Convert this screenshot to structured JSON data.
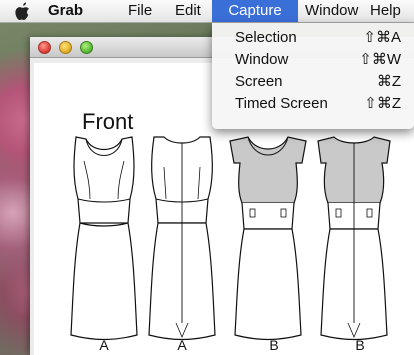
{
  "menubar": {
    "app_name": "Grab",
    "items": [
      "File",
      "Edit",
      "Capture",
      "Window",
      "Help"
    ],
    "active_menu": "Capture"
  },
  "capture_menu": {
    "items": [
      {
        "label": "Selection",
        "shortcut": "⇧⌘A"
      },
      {
        "label": "Window",
        "shortcut": "⇧⌘W"
      },
      {
        "label": "Screen",
        "shortcut": "⌘Z"
      },
      {
        "label": "Timed Screen",
        "shortcut": "⇧⌘Z"
      }
    ]
  },
  "document": {
    "heading": "Front",
    "figure_labels": [
      "A",
      "A",
      "B",
      "B"
    ]
  },
  "colors": {
    "menu_highlight": "#3b6fd8",
    "bodice_shade": "#c9c9c9"
  }
}
